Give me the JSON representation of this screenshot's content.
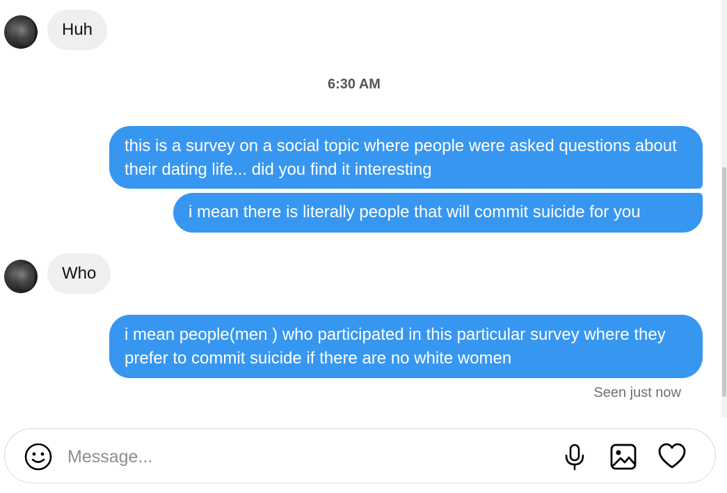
{
  "messages": [
    {
      "direction": "incoming",
      "text": "Huh"
    },
    {
      "direction": "outgoing",
      "text": "this is a survey on a social topic where people were asked questions about their dating life... did you find it interesting"
    },
    {
      "direction": "outgoing",
      "text": "i mean there is literally people that will commit suicide for you"
    },
    {
      "direction": "incoming",
      "text": "Who"
    },
    {
      "direction": "outgoing",
      "text": "i mean people(men ) who participated in this particular survey where they prefer to commit suicide if there are no white women"
    }
  ],
  "timestamp": "6:30 AM",
  "seen_status": "Seen just now",
  "composer": {
    "placeholder": "Message...",
    "icons": [
      "emoji-icon",
      "microphone-icon",
      "image-icon",
      "heart-icon"
    ]
  },
  "colors": {
    "outgoing_bubble": "#3797f0",
    "incoming_bubble": "#efefef",
    "background": "#ffffff"
  }
}
